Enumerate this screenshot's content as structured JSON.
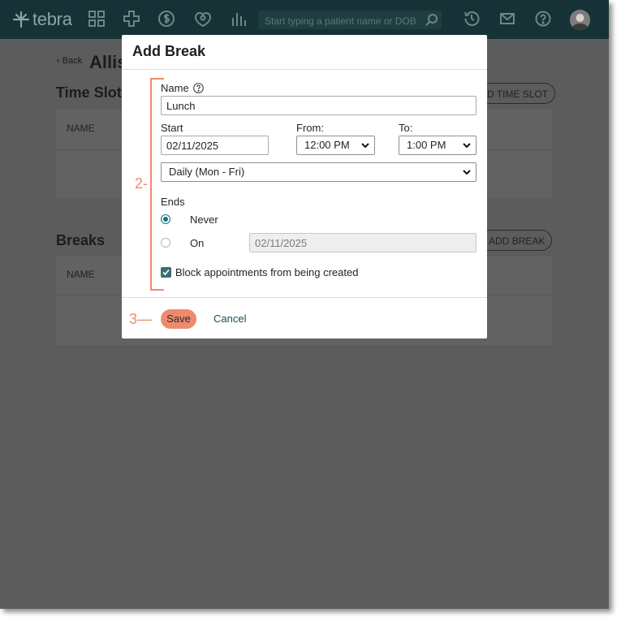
{
  "colors": {
    "topnav_bg": "#163236",
    "overlay_bg": "#5c5c5c",
    "accent_teal": "#12767f",
    "save_button": "#ef8a6e",
    "annotation_orange": "#ef8a6e"
  },
  "topnav": {
    "logo_text": "tebra",
    "search_placeholder": "Start typing a patient name or DOB",
    "icons": [
      "apps-grid-icon",
      "clinical-cross-icon",
      "billing-dollar-icon",
      "patient-engagement-icon",
      "reports-chart-icon",
      "history-icon",
      "mail-icon",
      "help-icon",
      "user-avatar"
    ]
  },
  "page": {
    "back_label": "Back",
    "title": "Allis",
    "time_slots": {
      "title": "Time Slot",
      "column_name": "NAME",
      "add_button": "D TIME SLOT"
    },
    "breaks": {
      "title": "Breaks",
      "column_name": "NAME",
      "add_button": "ADD BREAK"
    }
  },
  "modal": {
    "title": "Add Break",
    "name_label": "Name",
    "name_value": "Lunch",
    "start_label": "Start",
    "start_value": "02/11/2025",
    "from_label": "From:",
    "from_value": "12:00 PM",
    "to_label": "To:",
    "to_value": "1:00 PM",
    "recurrence_value": "Daily (Mon - Fri)",
    "ends_label": "Ends",
    "ends_options": [
      {
        "label": "Never",
        "selected": true
      },
      {
        "label": "On",
        "selected": false
      }
    ],
    "ends_on_date": "02/11/2025",
    "block_label": "Block appointments from being created",
    "block_checked": true,
    "save_label": "Save",
    "cancel_label": "Cancel"
  },
  "annotations": {
    "step2": "2-",
    "step3": "3—"
  }
}
